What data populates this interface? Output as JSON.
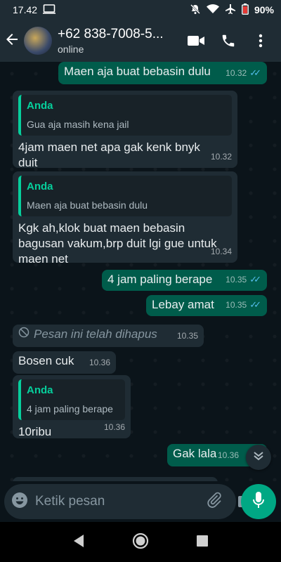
{
  "status_bar": {
    "time": "17.42",
    "battery": "90%"
  },
  "header": {
    "name": "+62 838-7008-5...",
    "status": "online"
  },
  "messages": [
    {
      "text": "Maen aja buat bebasin dulu",
      "time": "10.32"
    },
    {
      "quote_author": "Anda",
      "quote_text": "Gua aja masih kena jail",
      "text": "4jam maen net apa gak kenk bnyk duit",
      "time": "10.32"
    },
    {
      "quote_author": "Anda",
      "quote_text": "Maen aja buat bebasin dulu",
      "text": "Kgk ah,klok buat maen bebasin bagusan vakum,brp duit lgi gue untuk maen net",
      "time": "10.34"
    },
    {
      "text": "4 jam paling berape",
      "time": "10.35"
    },
    {
      "text": "Lebay amat",
      "time": "10.35"
    },
    {
      "text": "Pesan ini telah dihapus",
      "time": "10.35"
    },
    {
      "text": "Bosen cuk",
      "time": "10.36"
    },
    {
      "quote_author": "Anda",
      "quote_text": "4 jam paling berape",
      "text": "10ribu",
      "time": "10.36"
    },
    {
      "text": "Gak lala",
      "time": "10.36"
    }
  ],
  "input": {
    "placeholder": "Ketik pesan"
  },
  "icons": [
    "mute-icon",
    "wifi-icon",
    "airplane-icon",
    "battery-icon",
    "video-call-icon",
    "phone-icon",
    "emoji-icon",
    "attach-icon",
    "camera-icon",
    "mic-icon"
  ],
  "colors": {
    "header": "#1f2c34",
    "outgoing": "#005c4b",
    "incoming": "#1f2c34",
    "accent": "#00a884",
    "read_ticks": "#53bdeb"
  }
}
